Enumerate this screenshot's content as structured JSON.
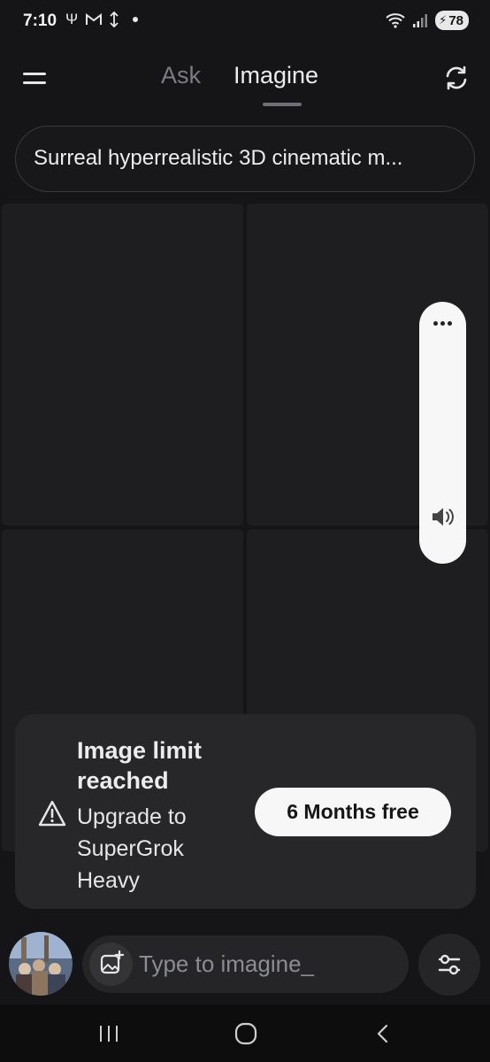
{
  "status_bar": {
    "time": "7:10",
    "battery": "78"
  },
  "header": {
    "tabs": [
      {
        "label": "Ask",
        "active": false
      },
      {
        "label": "Imagine",
        "active": true
      }
    ],
    "icons": {
      "menu": "menu-icon",
      "refresh": "refresh-icon"
    }
  },
  "prompt": {
    "text": "Surreal hyperrealistic 3D cinematic m..."
  },
  "volume_panel": {
    "icons": {
      "more": "more-dots-icon",
      "speaker": "speaker-icon"
    }
  },
  "limit_banner": {
    "title": "Image limit reached",
    "subtitle": "Upgrade to SuperGrok Heavy",
    "cta_label": "6 Months free",
    "icon": "warning-icon"
  },
  "composer": {
    "placeholder": "Type to imagine_",
    "icons": {
      "add_image": "image-add-icon",
      "settings": "sliders-icon"
    }
  },
  "nav": {
    "icons": [
      "recent-apps-icon",
      "home-icon",
      "back-icon"
    ]
  },
  "colors": {
    "background": "#151517",
    "tile": "#1e1e20",
    "card": "#272729",
    "muted_text": "#7c7d82",
    "cta_background": "#f7f7f7"
  }
}
